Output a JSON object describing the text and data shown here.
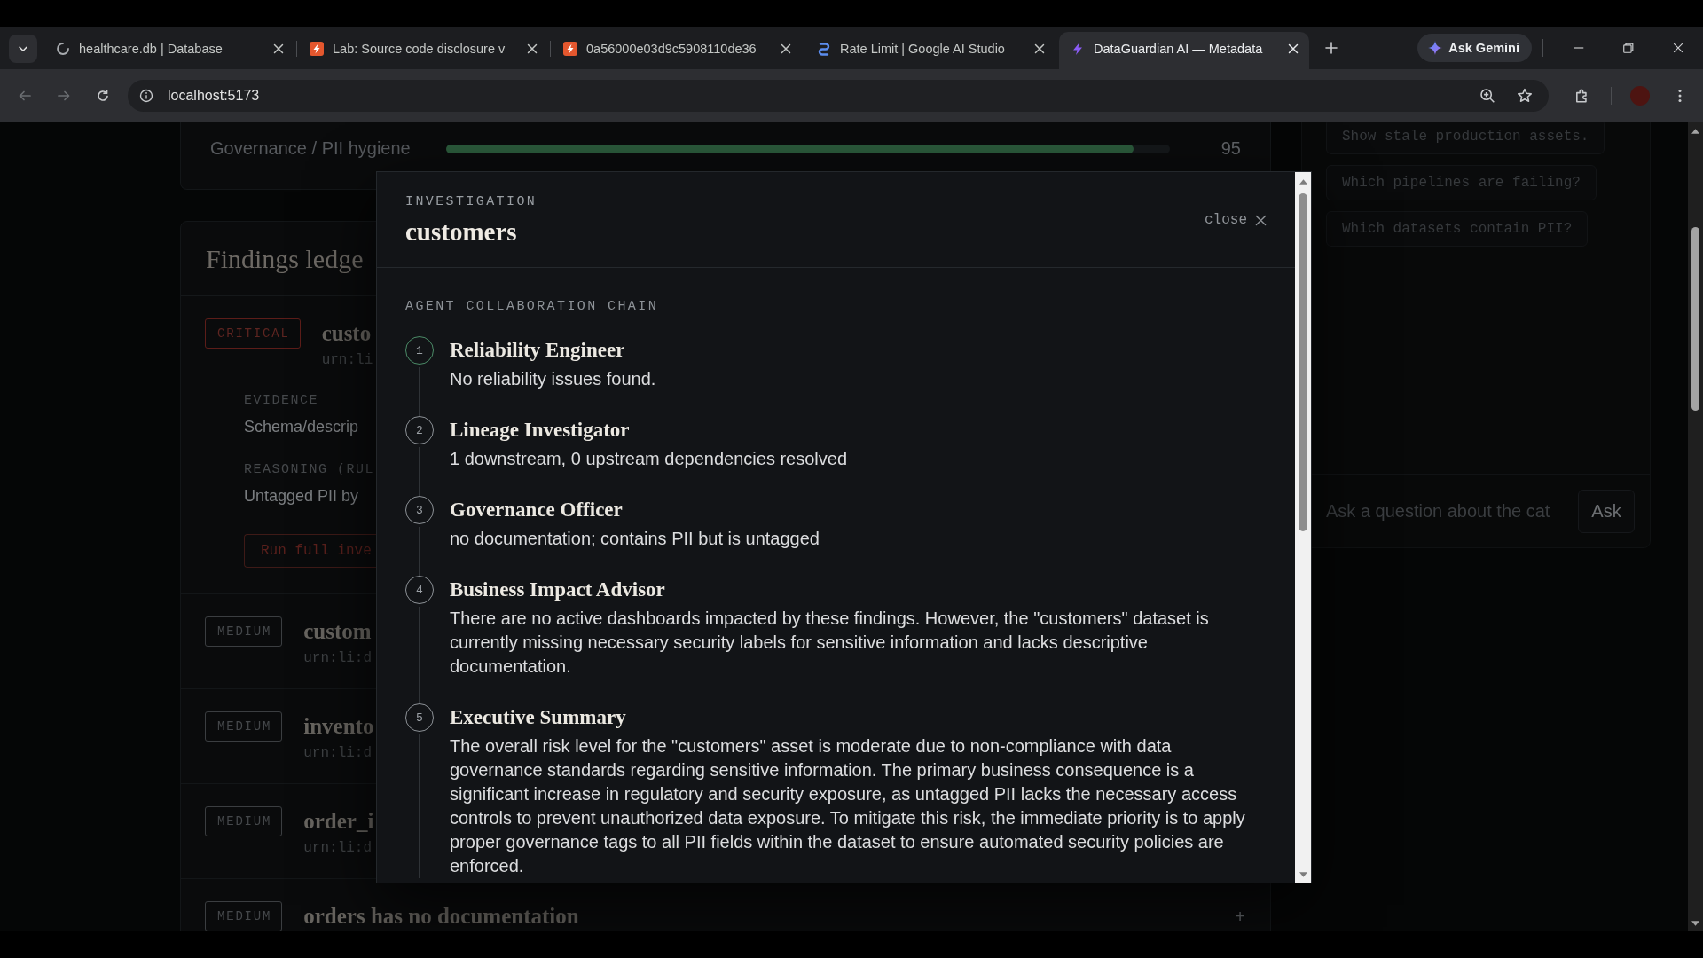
{
  "browser": {
    "tabs": [
      {
        "kind": "spinner",
        "title": "healthcare.db | Database",
        "selected": false
      },
      {
        "kind": "tile",
        "title": "Lab: Source code disclosure v",
        "selected": false
      },
      {
        "kind": "tile",
        "title": "0a56000e03d9c5908110de36",
        "selected": false
      },
      {
        "kind": "swirl",
        "title": "Rate Limit | Google AI Studio",
        "selected": false
      },
      {
        "kind": "bolt",
        "title": "DataGuardian AI — Metadata",
        "selected": true
      }
    ],
    "assistant_button": "Ask Gemini",
    "nav": [
      {
        "kind": "back",
        "disabled": true
      },
      {
        "kind": "forward",
        "disabled": true
      },
      {
        "kind": "reload",
        "disabled": false
      }
    ],
    "address": "localhost:5173"
  },
  "page": {
    "governance": {
      "label": "Governance / PII hygiene",
      "level": 0.95,
      "value": "95"
    },
    "findings": {
      "title": "Findings ledge",
      "rows": [
        {
          "kind": "critical",
          "severity": "CRITICAL",
          "title": "custo",
          "urn": "urn:li",
          "evidence_label": "EVIDENCE",
          "evidence": "Schema/descrip",
          "reasoning_label": "REASONING (RUL",
          "reasoning": "Untagged PII by",
          "action": "Run full inve"
        },
        {
          "kind": "medium",
          "severity": "MEDIUM",
          "title": "custom",
          "urn": "urn:li:d"
        },
        {
          "kind": "medium",
          "severity": "MEDIUM",
          "title": "invento",
          "urn": "urn:li:d"
        },
        {
          "kind": "medium",
          "severity": "MEDIUM",
          "title": "order_i",
          "urn": "urn:li:d"
        },
        {
          "kind": "medium",
          "severity": "MEDIUM",
          "title": "orders has no documentation",
          "toggle": "+"
        }
      ]
    },
    "assistant": {
      "suggestions": [
        "Show stale production assets.",
        "Which pipelines are failing?",
        "Which datasets contain PII?"
      ],
      "input": {
        "placeholder": "Ask a question about the cat"
      },
      "submit": "Ask"
    }
  },
  "modal": {
    "eyebrow": "INVESTIGATION",
    "title": "customers",
    "close": "close",
    "section": "AGENT COLLABORATION CHAIN",
    "steps": [
      {
        "number": "1",
        "title": "Reliability Engineer",
        "text": "No reliability issues found.",
        "active": true
      },
      {
        "number": "2",
        "title": "Lineage Investigator",
        "text": "1 downstream, 0 upstream dependencies resolved",
        "active": false
      },
      {
        "number": "3",
        "title": "Governance Officer",
        "text": "no documentation; contains PII but is untagged",
        "active": false
      },
      {
        "number": "4",
        "title": "Business Impact Advisor",
        "text": "There are no active dashboards impacted by these findings. However, the \"customers\" dataset is currently missing necessary security labels for sensitive information and lacks descriptive documentation.",
        "active": false
      },
      {
        "number": "5",
        "title": "Executive Summary",
        "text": "The overall risk level for the \"customers\" asset is moderate due to non-compliance with data governance standards regarding sensitive information. The primary business consequence is a significant increase in regulatory and security exposure, as untagged PII lacks the necessary access controls to prevent unauthorized data exposure. To mitigate this risk, the immediate priority is to apply proper governance tags to all PII fields within the dataset to ensure automated security policies are enforced.",
        "active": false
      }
    ]
  }
}
